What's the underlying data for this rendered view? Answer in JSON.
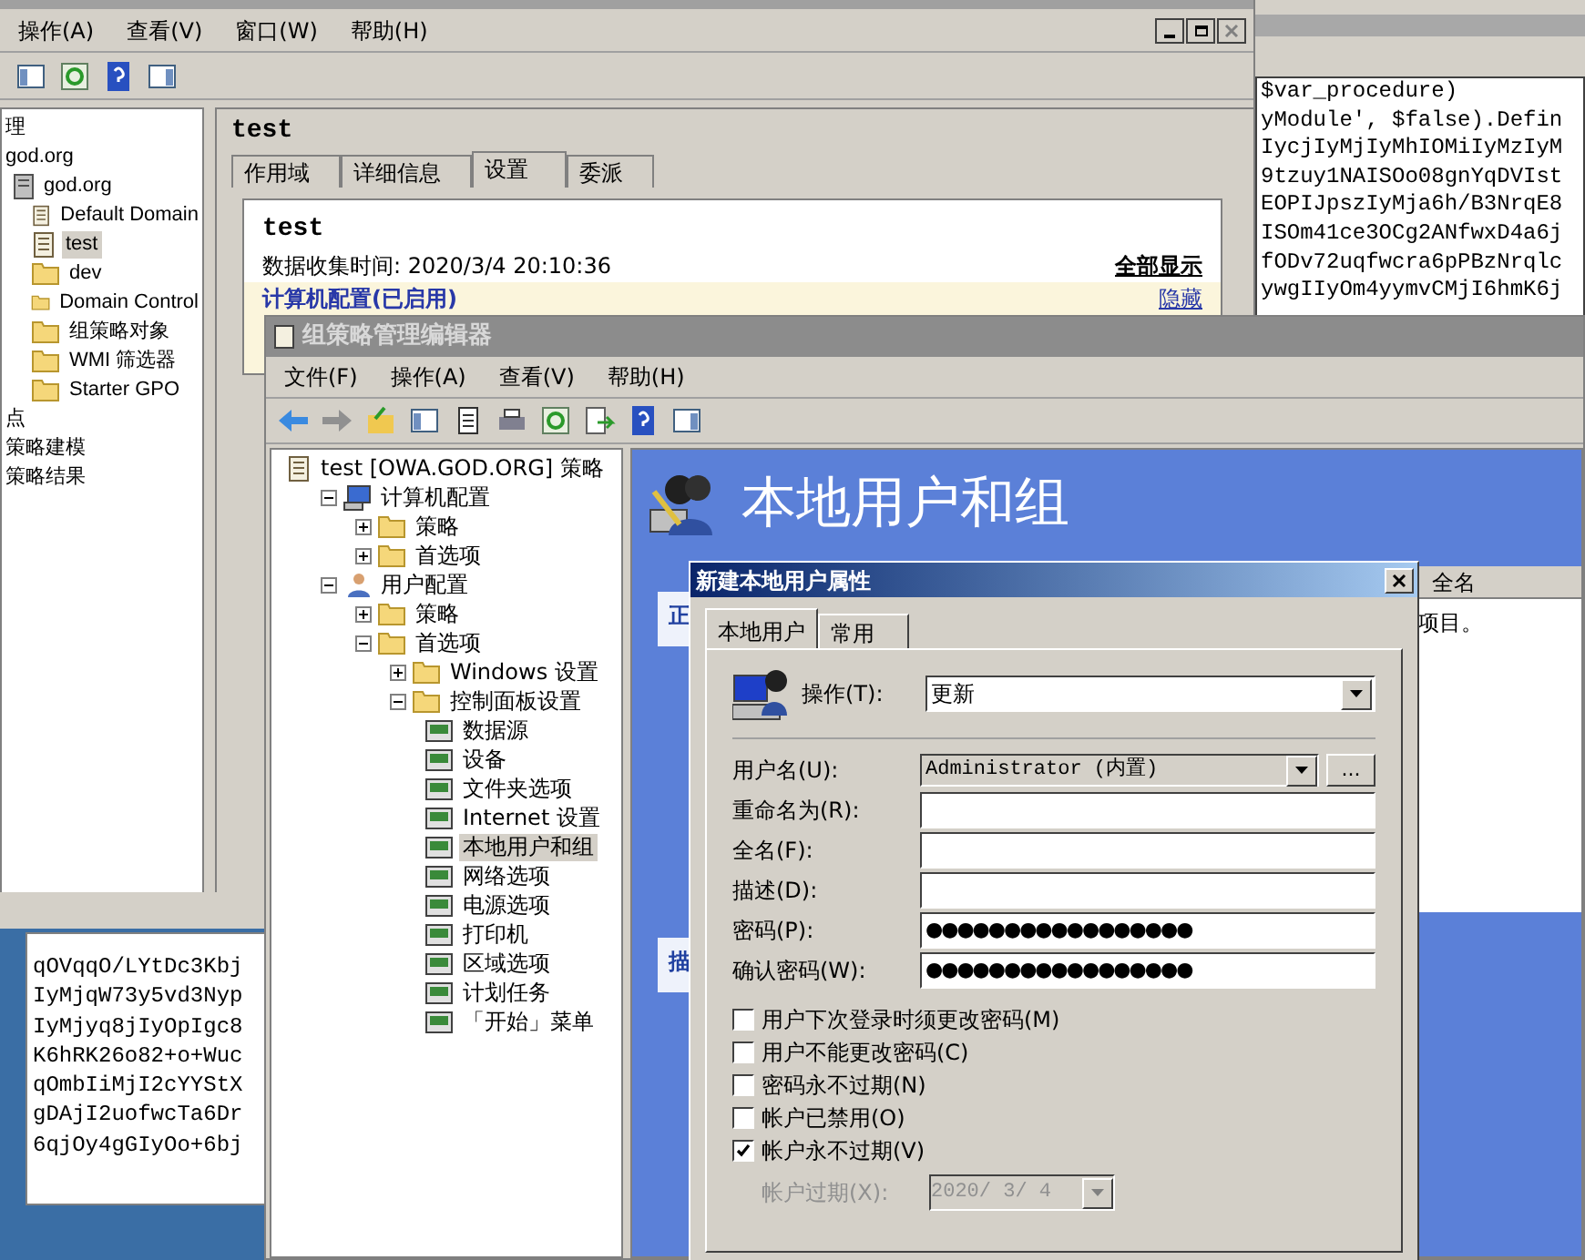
{
  "gpmc": {
    "menu": [
      "操作(A)",
      "查看(V)",
      "窗口(W)",
      "帮助(H)"
    ],
    "tree": [
      {
        "label": "理",
        "selected": false,
        "children": [
          {
            "label": "god.org",
            "selected": false,
            "children": [
              {
                "label": "god.org",
                "kind": "domain",
                "selected": false,
                "children": [
                  {
                    "label": "Default Domain",
                    "kind": "gpo",
                    "selected": false
                  },
                  {
                    "label": "test",
                    "kind": "gpo",
                    "selected": true
                  },
                  {
                    "label": "dev",
                    "kind": "folder",
                    "selected": false
                  },
                  {
                    "label": "Domain Control",
                    "kind": "folder",
                    "selected": false
                  },
                  {
                    "label": "组策略对象",
                    "kind": "folder",
                    "selected": false
                  },
                  {
                    "label": "WMI 筛选器",
                    "kind": "folder",
                    "selected": false
                  },
                  {
                    "label": "Starter GPO",
                    "kind": "folder",
                    "selected": false
                  }
                ]
              }
            ]
          }
        ]
      },
      {
        "label": "点",
        "selected": false
      },
      {
        "label": "策略建模",
        "selected": false
      },
      {
        "label": "策略结果",
        "selected": false
      }
    ],
    "details": {
      "title": "test",
      "tabs": [
        {
          "label": "作用域",
          "selected": false
        },
        {
          "label": "详细信息",
          "selected": false
        },
        {
          "label": "设置",
          "selected": true
        },
        {
          "label": "委派",
          "selected": false
        }
      ],
      "report": {
        "title": "test",
        "collected": "数据收集时间: 2020/3/4 20:10:36",
        "show_all": "全部显示",
        "section": "计算机配置(已启用)",
        "hide": "隐藏"
      }
    }
  },
  "code_right": {
    "lines": [
      "$var_procedure)",
      "yModule', $false).Defin",
      "IycjIyMjIyMhIOMiIyMzIyM",
      "9tzuy1NAISOo08gnYqDVIst",
      "EOPIJpszIyMja6h/B3NrqE8",
      "ISOm41ce3OCg2ANfwxD4a6j",
      "fODv72uqfwcra6pPBzNrqlc",
      "ywgIIyOm4yymvCMjI6hmK6j"
    ]
  },
  "code_left": {
    "lines": [
      "qOVqqO/LYtDc3Kbj",
      "IyMjqW73y5vd3Nyp",
      "IyMjyq8jIyOpIgc8",
      "K6hRK26o82+o+Wuc",
      "qOmbIiMjI2cYYStX",
      "gDAjI2uofwcTa6Dr",
      "6qjOy4gGIyOo+6bj"
    ]
  },
  "editor": {
    "title": "组策略管理编辑器",
    "menu": [
      "文件(F)",
      "操作(A)",
      "查看(V)",
      "帮助(H)"
    ],
    "tree": [
      {
        "label": "test [OWA.GOD.ORG] 策略",
        "kind": "policy",
        "selected": false,
        "children": [
          {
            "label": "计算机配置",
            "kind": "computer",
            "expanded": true,
            "selected": false,
            "children": [
              {
                "label": "策略",
                "kind": "folder",
                "expanded": false,
                "selected": false
              },
              {
                "label": "首选项",
                "kind": "folder",
                "expanded": false,
                "selected": false
              }
            ]
          },
          {
            "label": "用户配置",
            "kind": "user",
            "expanded": true,
            "selected": false,
            "children": [
              {
                "label": "策略",
                "kind": "folder",
                "expanded": false,
                "selected": false
              },
              {
                "label": "首选项",
                "kind": "folder",
                "expanded": true,
                "selected": false,
                "children": [
                  {
                    "label": "Windows 设置",
                    "kind": "folder",
                    "expanded": false,
                    "selected": false
                  },
                  {
                    "label": "控制面板设置",
                    "kind": "folder",
                    "expanded": true,
                    "selected": false,
                    "children": [
                      {
                        "label": "数据源",
                        "kind": "item",
                        "selected": false
                      },
                      {
                        "label": "设备",
                        "kind": "item",
                        "selected": false
                      },
                      {
                        "label": "文件夹选项",
                        "kind": "item",
                        "selected": false
                      },
                      {
                        "label": "Internet 设置",
                        "kind": "item",
                        "selected": false
                      },
                      {
                        "label": "本地用户和组",
                        "kind": "item",
                        "selected": true
                      },
                      {
                        "label": "网络选项",
                        "kind": "item",
                        "selected": false
                      },
                      {
                        "label": "电源选项",
                        "kind": "item",
                        "selected": false
                      },
                      {
                        "label": "打印机",
                        "kind": "item",
                        "selected": false
                      },
                      {
                        "label": "区域选项",
                        "kind": "item",
                        "selected": false
                      },
                      {
                        "label": "计划任务",
                        "kind": "item",
                        "selected": false
                      },
                      {
                        "label": "「开始」菜单",
                        "kind": "item",
                        "selected": false
                      }
                    ]
                  }
                ]
              }
            ]
          }
        ]
      }
    ],
    "header": "本地用户和组",
    "panel_1": "正",
    "panel_2": "描",
    "list": {
      "column": "全名",
      "text": "项目。"
    }
  },
  "dialog": {
    "title": "新建本地用户属性",
    "tabs": [
      {
        "label": "本地用户",
        "selected": true
      },
      {
        "label": "常用",
        "selected": false
      }
    ],
    "action": {
      "label": "操作(T):",
      "value": "更新"
    },
    "fields": [
      {
        "label": "用户名(U):",
        "kind": "combo",
        "value": "Administrator (内置)",
        "button": "..."
      },
      {
        "label": "重命名为(R):",
        "kind": "text"
      },
      {
        "label": "全名(F):",
        "kind": "text"
      },
      {
        "label": "描述(D):",
        "kind": "text"
      },
      {
        "label": "密码(P):",
        "kind": "password",
        "value": "●●●●●●●●●●●●●●●●●"
      },
      {
        "label": "确认密码(W):",
        "kind": "password",
        "value": "●●●●●●●●●●●●●●●●●"
      }
    ],
    "checkboxes": [
      {
        "label": "用户下次登录时须更改密码(M)",
        "checked": false
      },
      {
        "label": "用户不能更改密码(C)",
        "checked": false
      },
      {
        "label": "密码永不过期(N)",
        "checked": false
      },
      {
        "label": "帐户已禁用(O)",
        "checked": false
      },
      {
        "label": "帐户永不过期(V)",
        "checked": true
      }
    ],
    "expiry": {
      "label": "帐户过期(X):",
      "value": "2020/ 3/ 4",
      "disabled": true
    }
  }
}
